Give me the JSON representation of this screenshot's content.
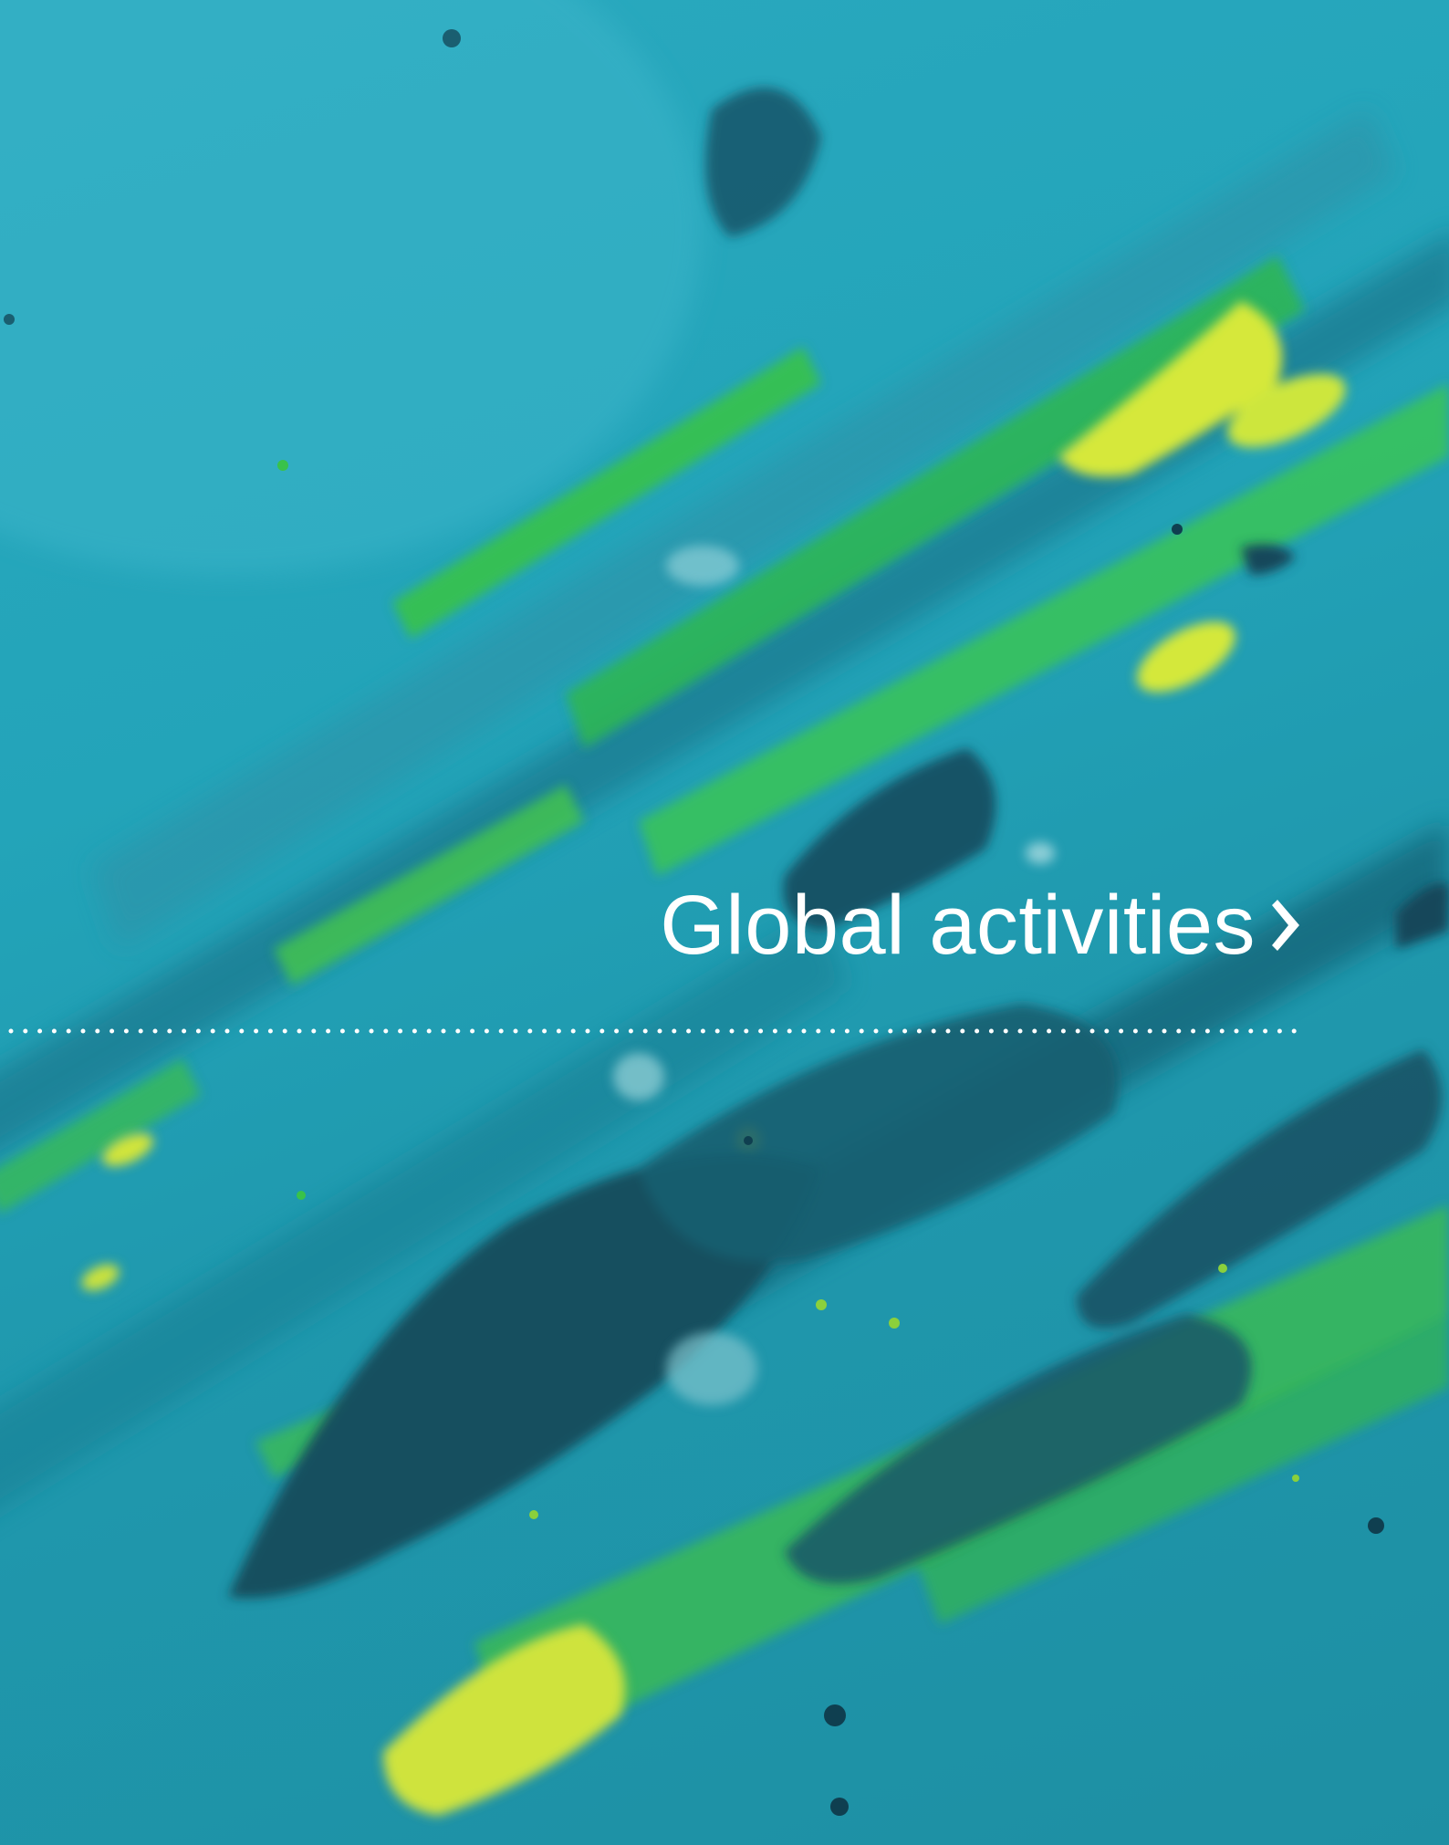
{
  "section": {
    "title": "Global activities",
    "arrow_icon": "chevron-right-icon"
  },
  "colors": {
    "background_teal": "#23a4b9",
    "stroke_dark": "#14566a",
    "stroke_green": "#39c24a",
    "stroke_yellow": "#d6e83a",
    "text": "#ffffff"
  }
}
